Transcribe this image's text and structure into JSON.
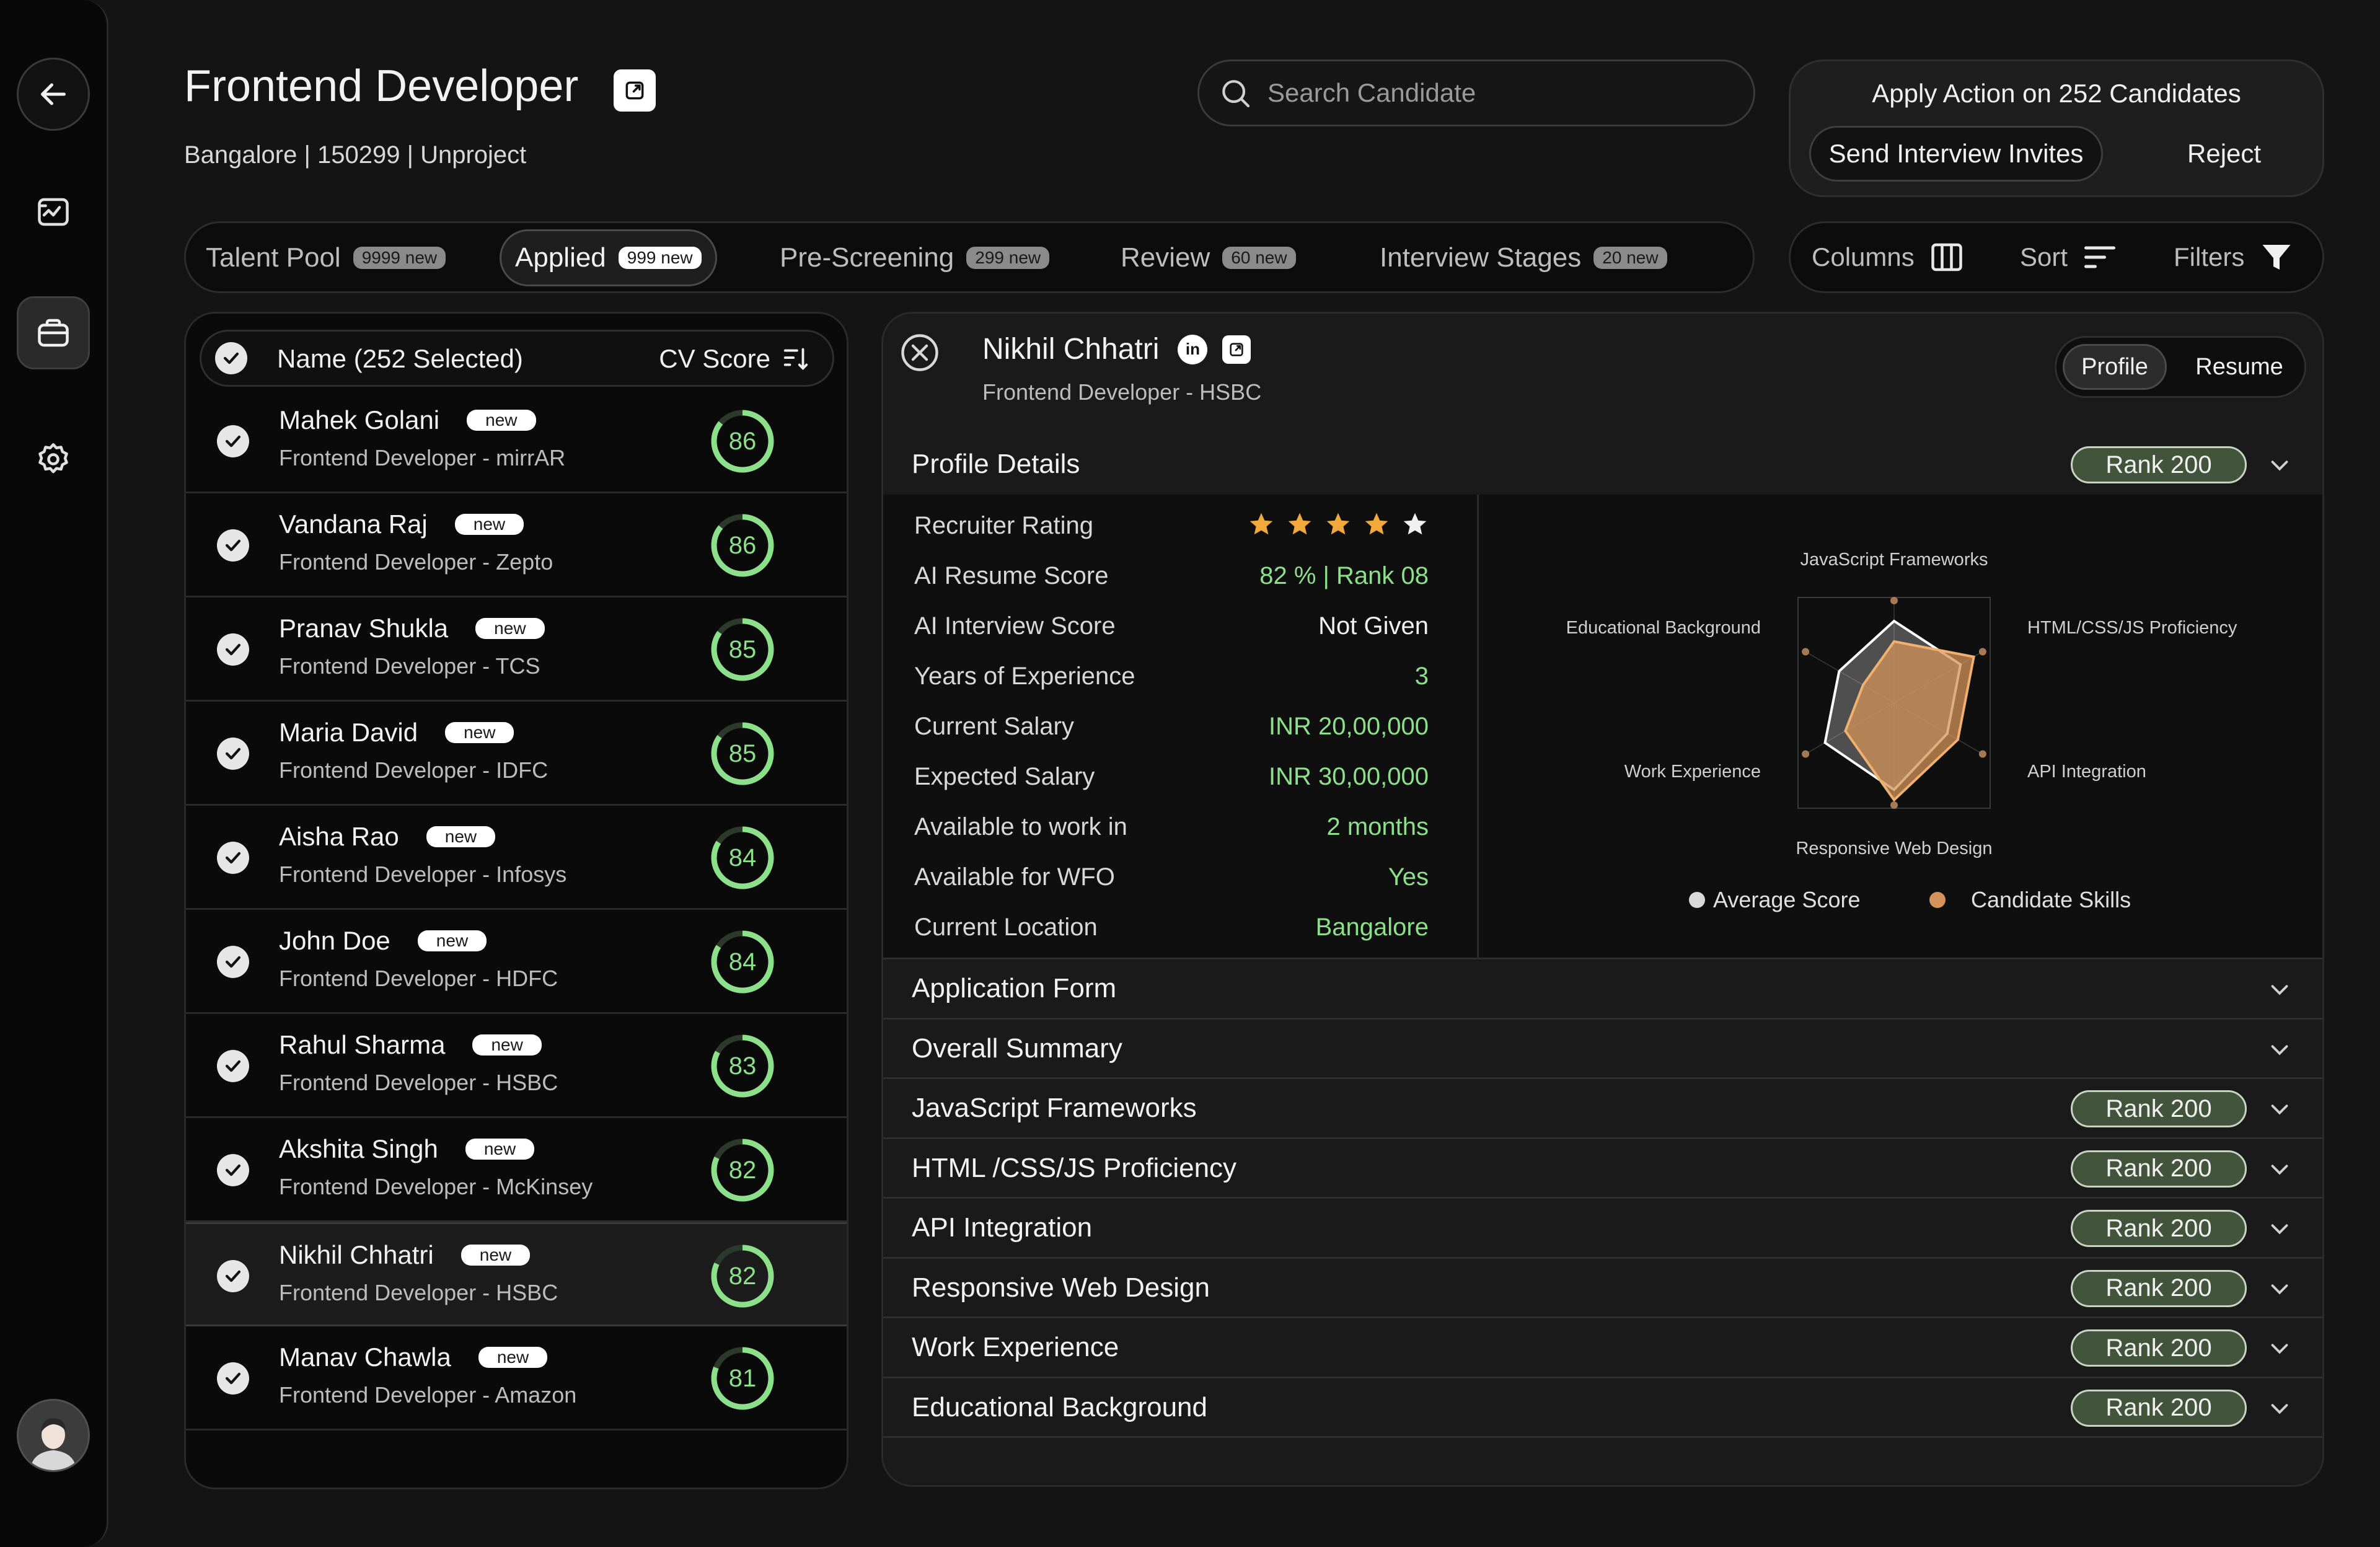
{
  "header": {
    "title": "Frontend Developer",
    "subtitle": "Bangalore | 150299 | Unproject"
  },
  "search": {
    "placeholder": "Search Candidate",
    "value": ""
  },
  "bulk_action": {
    "title": "Apply Action on 252 Candidates",
    "invite_label": "Send Interview Invites",
    "reject_label": "Reject"
  },
  "tabs": [
    {
      "label": "Talent Pool",
      "badge": "9999 new"
    },
    {
      "label": "Applied",
      "badge": "999 new"
    },
    {
      "label": "Pre-Screening",
      "badge": "299 new"
    },
    {
      "label": "Review",
      "badge": "60 new"
    },
    {
      "label": "Interview Stages",
      "badge": "20 new"
    }
  ],
  "tools": {
    "columns": "Columns",
    "sort": "Sort",
    "filters": "Filters"
  },
  "list": {
    "header_label": "Name (252 Selected)",
    "score_label": "CV Score",
    "candidates": [
      {
        "name": "Mahek Golani",
        "tag": "new",
        "role": "Frontend Developer - mirrAR",
        "score": "86"
      },
      {
        "name": "Vandana Raj",
        "tag": "new",
        "role": "Frontend Developer - Zepto",
        "score": "86"
      },
      {
        "name": "Pranav Shukla",
        "tag": "new",
        "role": "Frontend Developer - TCS",
        "score": "85"
      },
      {
        "name": "Maria David",
        "tag": "new",
        "role": "Frontend Developer - IDFC",
        "score": "85"
      },
      {
        "name": "Aisha Rao",
        "tag": "new",
        "role": "Frontend Developer - Infosys",
        "score": "84"
      },
      {
        "name": "John Doe",
        "tag": "new",
        "role": "Frontend Developer - HDFC",
        "score": "84"
      },
      {
        "name": "Rahul Sharma",
        "tag": "new",
        "role": "Frontend Developer - HSBC",
        "score": "83"
      },
      {
        "name": "Akshita Singh",
        "tag": "new",
        "role": "Frontend Developer - McKinsey",
        "score": "82"
      },
      {
        "name": "Nikhil Chhatri",
        "tag": "new",
        "role": "Frontend Developer - HSBC",
        "score": "82"
      },
      {
        "name": "Manav Chawla",
        "tag": "new",
        "role": "Frontend Developer - Amazon",
        "score": "81"
      }
    ]
  },
  "detail": {
    "name": "Nikhil Chhatri",
    "linkedin_glyph": "in",
    "role": "Frontend Developer - HSBC",
    "toggle": {
      "profile": "Profile",
      "resume": "Resume"
    },
    "profile_details_label": "Profile Details",
    "rank": "Rank 200",
    "fields": [
      {
        "label": "Recruiter Rating",
        "value": ""
      },
      {
        "label": "AI Resume Score",
        "value": "82 % | Rank 08"
      },
      {
        "label": "AI Interview Score",
        "value": "Not Given"
      },
      {
        "label": "Years of Experience",
        "value": "3"
      },
      {
        "label": "Current Salary",
        "value": "INR 20,00,000"
      },
      {
        "label": "Expected Salary",
        "value": "INR 30,00,000"
      },
      {
        "label": "Available to work in",
        "value": "2 months"
      },
      {
        "label": "Available for WFO",
        "value": "Yes"
      },
      {
        "label": "Current Location",
        "value": "Bangalore"
      }
    ],
    "rating_stars": 5,
    "radar": {
      "axes": [
        "JavaScript Frameworks",
        "HTML/CSS/JS Proficiency",
        "API Integration",
        "Responsive Web Design",
        "Work Experience",
        "Educational Background"
      ],
      "average": [
        0.8,
        0.75,
        0.6,
        0.85,
        0.78,
        0.62
      ],
      "candidate": [
        0.6,
        0.9,
        0.72,
        0.95,
        0.55,
        0.35
      ],
      "legend_average": "Average Score",
      "legend_candidate": "Candidate Skills",
      "colors": {
        "average": "#d9d9d9",
        "candidate": "#d4935a"
      }
    },
    "sections": [
      {
        "label": "Application Form",
        "rank": ""
      },
      {
        "label": "Overall Summary",
        "rank": ""
      },
      {
        "label": "JavaScript Frameworks",
        "rank": "Rank 200"
      },
      {
        "label": "HTML /CSS/JS Proficiency",
        "rank": "Rank 200"
      },
      {
        "label": "API Integration",
        "rank": "Rank 200"
      },
      {
        "label": "Responsive Web Design",
        "rank": "Rank 200"
      },
      {
        "label": "Work Experience",
        "rank": "Rank 200"
      },
      {
        "label": "Educational Background",
        "rank": "Rank 200"
      }
    ]
  },
  "colors": {
    "accent_green": "#8de08a",
    "rank_pill": "#43543d",
    "star": "#f2a93b"
  }
}
